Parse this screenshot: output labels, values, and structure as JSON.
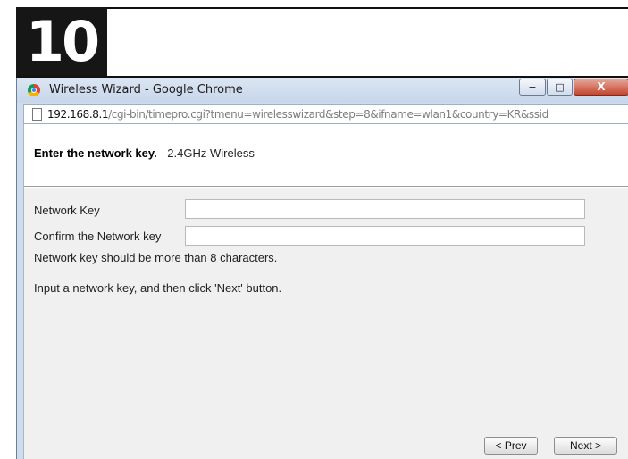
{
  "step_number": "10",
  "window": {
    "title": "Wireless Wizard - Google Chrome",
    "controls": {
      "minimize": "−",
      "maximize": "□",
      "close": "X"
    }
  },
  "address_bar": {
    "host": "192.168.8.1",
    "path": "/cgi-bin/timepro.cgi?tmenu=wirelesswizard&step=8&ifname=wlan1&country=KR&ssid"
  },
  "header": {
    "title_bold": "Enter the network key.",
    "title_rest": " - 2.4GHz Wireless"
  },
  "form": {
    "network_key_label": "Network Key",
    "network_key_value": "",
    "confirm_key_label": "Confirm the Network key",
    "confirm_key_value": "",
    "hint": "Network key should be more than 8 characters.",
    "instruction": "Input a network key, and then click 'Next' button."
  },
  "buttons": {
    "prev": "< Prev",
    "next": "Next >"
  }
}
